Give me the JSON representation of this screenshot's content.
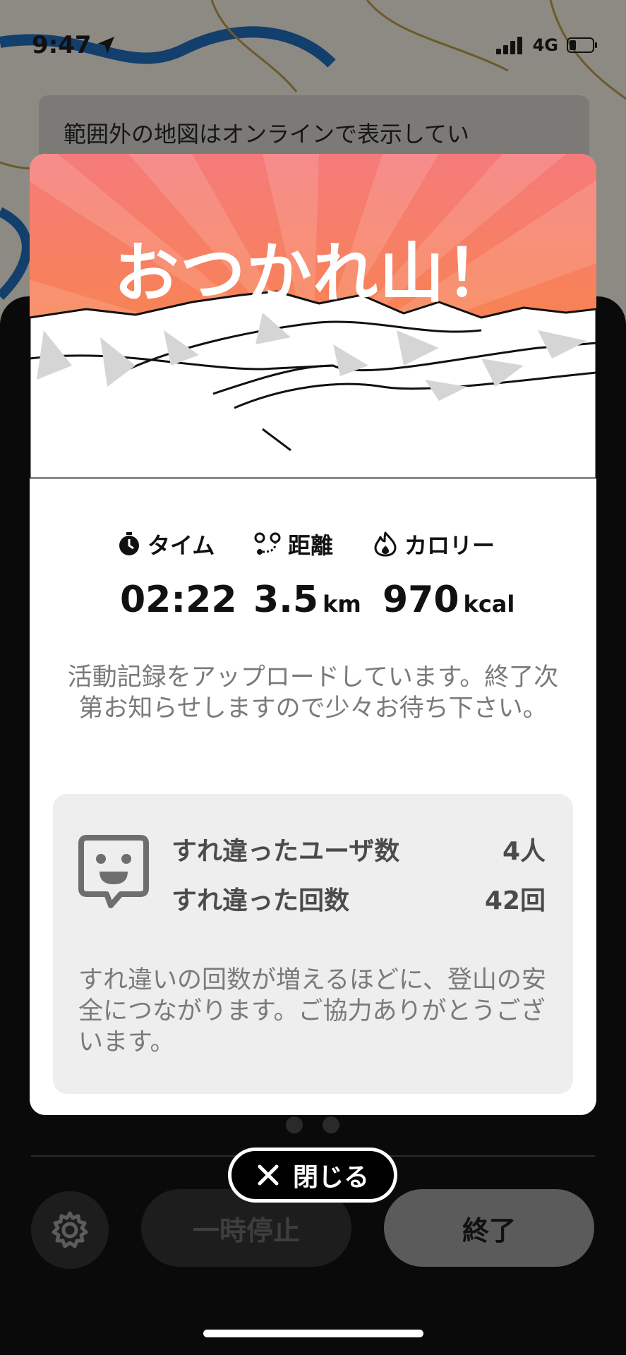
{
  "status_bar": {
    "time": "9:47",
    "network": "4G",
    "icons": [
      "location-arrow-icon",
      "signal-icon",
      "battery-icon"
    ]
  },
  "map": {
    "banner_text": "範囲外の地図はオンラインで表示してい"
  },
  "card": {
    "title": "おつかれ山！",
    "stats": [
      {
        "icon": "stopwatch-icon",
        "label": "タイム",
        "value": "02:22",
        "unit": ""
      },
      {
        "icon": "route-icon",
        "label": "距離",
        "value": "3.5",
        "unit": "km"
      },
      {
        "icon": "flame-icon",
        "label": "カロリー",
        "value": "970",
        "unit": "kcal"
      }
    ],
    "upload_message": "活動記録をアップロードしています。終了次第お知らせしますので少々お待ち下さい。",
    "passing": {
      "icon": "smiley-chat-icon",
      "rows": [
        {
          "label": "すれ違ったユーザ数",
          "value": "4人"
        },
        {
          "label": "すれ違った回数",
          "value": "42回"
        }
      ],
      "note": "すれ違いの回数が増えるほどに、登山の安全につながります。ご協力ありがとうございます。"
    }
  },
  "close_button": {
    "icon": "close-icon",
    "label": "閉じる"
  },
  "controls": {
    "settings_icon": "gear-icon",
    "pause_label": "一時停止",
    "finish_label": "終了"
  },
  "colors": {
    "hero_top": "#f57b7b",
    "hero_bottom": "#fb8a2e",
    "card_bg": "#ffffff",
    "panel_bg": "#0a0a0a"
  }
}
